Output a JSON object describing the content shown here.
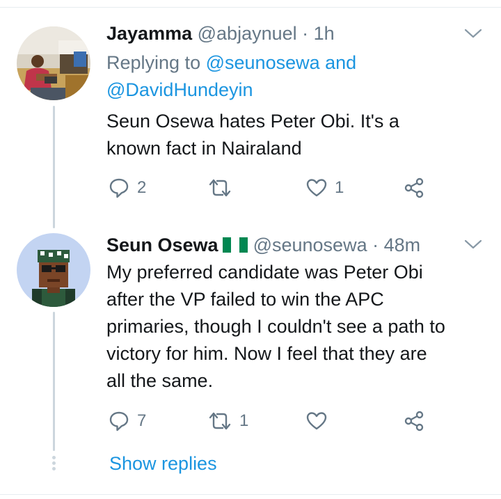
{
  "tweets": [
    {
      "name": "Jayamma",
      "handle": "@abjaynuel",
      "time": "· 1h",
      "replying_prefix": "Replying to",
      "replying_mention1": "@seunosewa",
      "replying_and": "and",
      "replying_mention2": "@DavidHundeyin",
      "text_line1": "Seun Osewa hates Peter Obi. It's a",
      "text_line2": "known fact in Nairaland",
      "replies": "2",
      "retweets": "",
      "likes": "1"
    },
    {
      "name": "Seun Osewa",
      "handle": "@seunosewa",
      "time": "· 48m",
      "text_line1": "My preferred candidate was Peter Obi",
      "text_line2": "after the VP failed to win the APC",
      "text_line3": "primaries, though I couldn't see a path to",
      "text_line4": "victory for him. Now I feel that they are",
      "text_line5": "all the same.",
      "replies": "7",
      "retweets": "1",
      "likes": ""
    }
  ],
  "show_replies": "Show replies",
  "colors": {
    "accent": "#1b95e0",
    "secondary_text": "#657786",
    "thread_line": "#ccd6dd",
    "flag_green": "#008751"
  },
  "icons": [
    "reply-icon",
    "retweet-icon",
    "like-icon",
    "share-icon",
    "chevron-down-icon",
    "nigeria-flag-icon"
  ]
}
